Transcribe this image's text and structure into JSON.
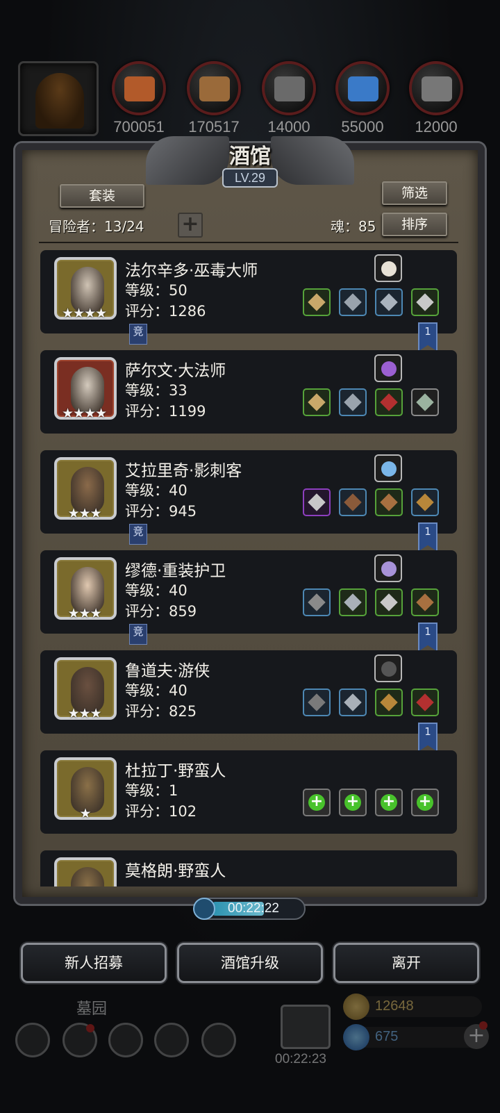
{
  "resources": {
    "items": [
      {
        "icon": "food-icon",
        "value": "700051",
        "color": "#b25a2a"
      },
      {
        "icon": "wood-icon",
        "value": "170517",
        "color": "#9a6a3a"
      },
      {
        "icon": "stone-icon",
        "value": "14000",
        "color": "#6a6a6a"
      },
      {
        "icon": "crystal-icon",
        "value": "55000",
        "color": "#3a7ac8"
      },
      {
        "icon": "iron-icon",
        "value": "12000",
        "color": "#777777"
      }
    ]
  },
  "panel": {
    "title": "酒馆",
    "level": "LV.29",
    "set_button": "套装",
    "filter_button": "筛选",
    "sort_button": "排序",
    "adventurers": "冒险者：13/24",
    "souls": "魂：85",
    "plus": "+"
  },
  "heroes": [
    {
      "name": "法尔辛多·巫毒大师",
      "level": "等级：50",
      "score": "评分：1286",
      "stars": "★★★★",
      "frame": "gold",
      "face": "#cfc3b4",
      "skill_color": "#e8e2d6",
      "equips": [
        {
          "c": "eq-green",
          "g": "#c9a86a"
        },
        {
          "c": "eq-blue",
          "g": "#9aa3ad"
        },
        {
          "c": "eq-blue",
          "g": "#aab3bd"
        },
        {
          "c": "eq-green",
          "g": "#c8c8c8"
        }
      ],
      "tag": "竞",
      "ribbon": "1"
    },
    {
      "name": "萨尔文·大法师",
      "level": "等级：33",
      "score": "评分：1199",
      "stars": "★★★★",
      "frame": "red",
      "face": "#d4cabd",
      "skill_color": "#9b5fd1",
      "equips": [
        {
          "c": "eq-green",
          "g": "#c9a86a"
        },
        {
          "c": "eq-blue",
          "g": "#9aa3ad"
        },
        {
          "c": "eq-green",
          "g": "#b33030"
        },
        {
          "c": "eq-gray",
          "g": "#9bb3a0"
        }
      ],
      "tag": "",
      "ribbon": ""
    },
    {
      "name": "艾拉里奇·影刺客",
      "level": "等级：40",
      "score": "评分：945",
      "stars": "★★★",
      "frame": "gold",
      "face": "#8a6a4a",
      "skill_color": "#7ab6e8",
      "equips": [
        {
          "c": "eq-purple",
          "g": "#c8c8c8"
        },
        {
          "c": "eq-blue",
          "g": "#8a5a3a"
        },
        {
          "c": "eq-green",
          "g": "#a87040"
        },
        {
          "c": "eq-blue",
          "g": "#b8873a"
        }
      ],
      "tag": "竞",
      "ribbon": "1"
    },
    {
      "name": "缪德·重装护卫",
      "level": "等级：40",
      "score": "评分：859",
      "stars": "★★★",
      "frame": "gold",
      "face": "#e0c8b0",
      "skill_color": "#a892d8",
      "equips": [
        {
          "c": "eq-blue",
          "g": "#8a8a8a"
        },
        {
          "c": "eq-green",
          "g": "#a9b0b8"
        },
        {
          "c": "eq-green",
          "g": "#c8c8c8"
        },
        {
          "c": "eq-green",
          "g": "#a87040"
        }
      ],
      "tag": "竞",
      "ribbon": "1"
    },
    {
      "name": "鲁道夫·游侠",
      "level": "等级：40",
      "score": "评分：825",
      "stars": "★★★",
      "frame": "gold",
      "face": "#6a5040",
      "skill_color": "#555555",
      "equips": [
        {
          "c": "eq-blue",
          "g": "#7a7a7a"
        },
        {
          "c": "eq-blue",
          "g": "#a9b0b8"
        },
        {
          "c": "eq-green",
          "g": "#b8873a"
        },
        {
          "c": "eq-green",
          "g": "#b33030"
        }
      ],
      "tag": "",
      "ribbon": "1"
    },
    {
      "name": "杜拉丁·野蛮人",
      "level": "等级：1",
      "score": "评分：102",
      "stars": "★",
      "frame": "gold",
      "face": "#8a7048",
      "skill_color": "",
      "equips": [],
      "empty_slots": 4,
      "tag": "",
      "ribbon": ""
    },
    {
      "name": "莫格朗·野蛮人",
      "level": "",
      "score": "",
      "stars": "",
      "frame": "gold",
      "face": "#8a7048",
      "skill_color": "",
      "equips": [],
      "tag": "",
      "ribbon": ""
    }
  ],
  "timer": {
    "text": "00:22:22"
  },
  "actions": {
    "recruit": "新人招募",
    "upgrade": "酒馆升级",
    "leave": "离开"
  },
  "hud": {
    "area": "墓园",
    "gift_timer": "00:22:23",
    "gold": "12648",
    "gems": "675"
  }
}
